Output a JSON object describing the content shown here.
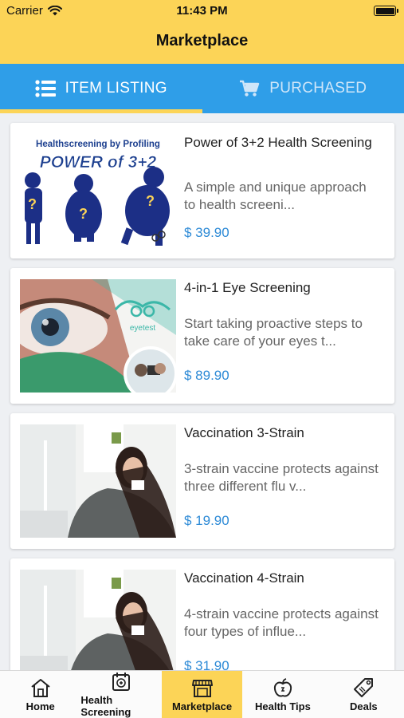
{
  "status_bar": {
    "carrier": "Carrier",
    "time": "11:43 PM"
  },
  "nav": {
    "title": "Marketplace"
  },
  "tabs": [
    {
      "label": "ITEM LISTING",
      "icon": "list-icon",
      "active": true
    },
    {
      "label": "PURCHASED",
      "icon": "cart-icon",
      "active": false
    }
  ],
  "items": [
    {
      "title": "Power of 3+2 Health Screening",
      "description": "A simple and unique approach to health screeni...",
      "price": "$ 39.90",
      "image_text_1": "Healthscreening by Profiling",
      "image_text_2": "POWER of 3+2",
      "image_text_3": "?"
    },
    {
      "title": "4-in-1 Eye Screening",
      "description": "Start taking proactive steps to take care of your eyes t...",
      "price": "$ 89.90",
      "image_text_1": "eyetest"
    },
    {
      "title": "Vaccination 3-Strain",
      "description": "3-strain vaccine protects against three different flu v...",
      "price": "$ 19.90"
    },
    {
      "title": "Vaccination 4-Strain",
      "description": "4-strain vaccine protects against four types of influe...",
      "price": "$ 31.90"
    }
  ],
  "tabbar": [
    {
      "label": "Home",
      "icon": "home-icon",
      "active": false
    },
    {
      "label": "Health Screening",
      "icon": "calendar-health-icon",
      "active": false
    },
    {
      "label": "Marketplace",
      "icon": "store-icon",
      "active": true
    },
    {
      "label": "Health Tips",
      "icon": "apple-icon",
      "active": false
    },
    {
      "label": "Deals",
      "icon": "tag-icon",
      "active": false
    }
  ],
  "colors": {
    "header_yellow": "#fcd457",
    "tab_blue": "#2f9ee8",
    "price_blue": "#2d8ad6"
  }
}
